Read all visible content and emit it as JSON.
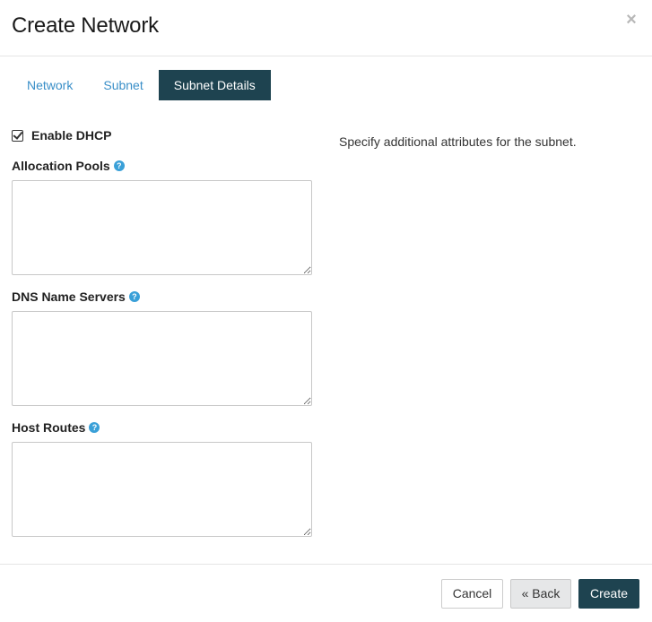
{
  "modal": {
    "title": "Create Network",
    "close_icon": "×"
  },
  "tabs": [
    {
      "label": "Network",
      "active": false
    },
    {
      "label": "Subnet",
      "active": false
    },
    {
      "label": "Subnet Details",
      "active": true
    }
  ],
  "form": {
    "enable_dhcp": {
      "label": "Enable DHCP",
      "checked": true
    },
    "allocation_pools": {
      "label": "Allocation Pools",
      "help_icon": "?",
      "value": ""
    },
    "dns_name_servers": {
      "label": "DNS Name Servers",
      "help_icon": "?",
      "value": ""
    },
    "host_routes": {
      "label": "Host Routes",
      "help_icon": "?",
      "value": ""
    }
  },
  "description": "Specify additional attributes for the subnet.",
  "footer": {
    "cancel_label": "Cancel",
    "back_label": "« Back",
    "create_label": "Create"
  },
  "colors": {
    "primary": "#1e4350",
    "link": "#3a8fc8",
    "help": "#3aa0d8"
  }
}
